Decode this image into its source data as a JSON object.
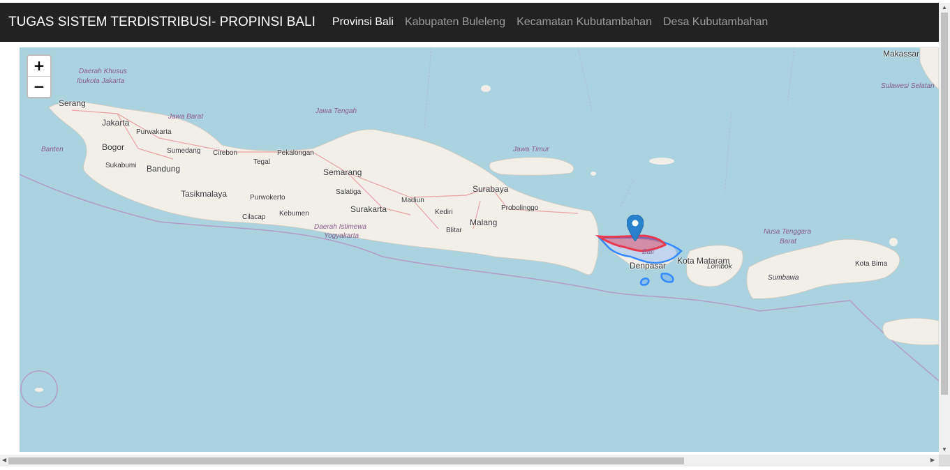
{
  "navbar": {
    "brand": "TUGAS SISTEM TERDISTRIBUSI- PROPINSI BALI",
    "items": [
      {
        "label": "Provinsi Bali",
        "active": true
      },
      {
        "label": "Kabupaten Buleleng",
        "active": false
      },
      {
        "label": "Kecamatan Kubutambahan",
        "active": false
      },
      {
        "label": "Desa Kubutambahan",
        "active": false
      }
    ]
  },
  "map": {
    "zoom_in": "+",
    "zoom_out": "−",
    "marker_icon": "map-pin-icon",
    "labels": {
      "makassar": "Makassar",
      "dki": "Daerah Khusus",
      "dki2": "Ibukota Jakarta",
      "sulsel": "Sulawesi Selatan",
      "serang": "Serang",
      "jakarta": "Jakarta",
      "jabar": "Jawa Barat",
      "jateng": "Jawa Tengah",
      "purwakarta": "Purwakarta",
      "banten": "Banten",
      "bogor": "Bogor",
      "sumedang": "Sumedang",
      "cirebon": "Cirebon",
      "pekalongan": "Pekalongan",
      "sukabumi": "Sukabumi",
      "bandung": "Bandung",
      "tegal": "Tegal",
      "semarang": "Semarang",
      "jatim": "Jawa Timur",
      "surabaya": "Surabaya",
      "tasikmalaya": "Tasikmalaya",
      "salatiga": "Salatiga",
      "purwokerto": "Purwokerto",
      "madiun": "Madiun",
      "surakarta": "Surakarta",
      "kediri": "Kediri",
      "probolinggo": "Probolinggo",
      "cilacap": "Cilacap",
      "kebumen": "Kebumen",
      "diy": "Daerah Istimewa",
      "diy2": "Yogyakarta",
      "malang": "Malang",
      "blitar": "Blitar",
      "ntb": "Nusa Tenggara",
      "ntb2": "Barat",
      "bali": "Bali",
      "denpasar": "Denpasar",
      "mataram": "Kota Mataram",
      "lombok": "Lombok",
      "kotabima": "Kota Bima",
      "sumbawa": "Sumbawa"
    }
  },
  "colors": {
    "sea": "#aad3df",
    "land": "#f2efe9",
    "highlight_blue": "#3388ff",
    "highlight_red": "#e8384f",
    "boundary": "#b29bc9"
  }
}
